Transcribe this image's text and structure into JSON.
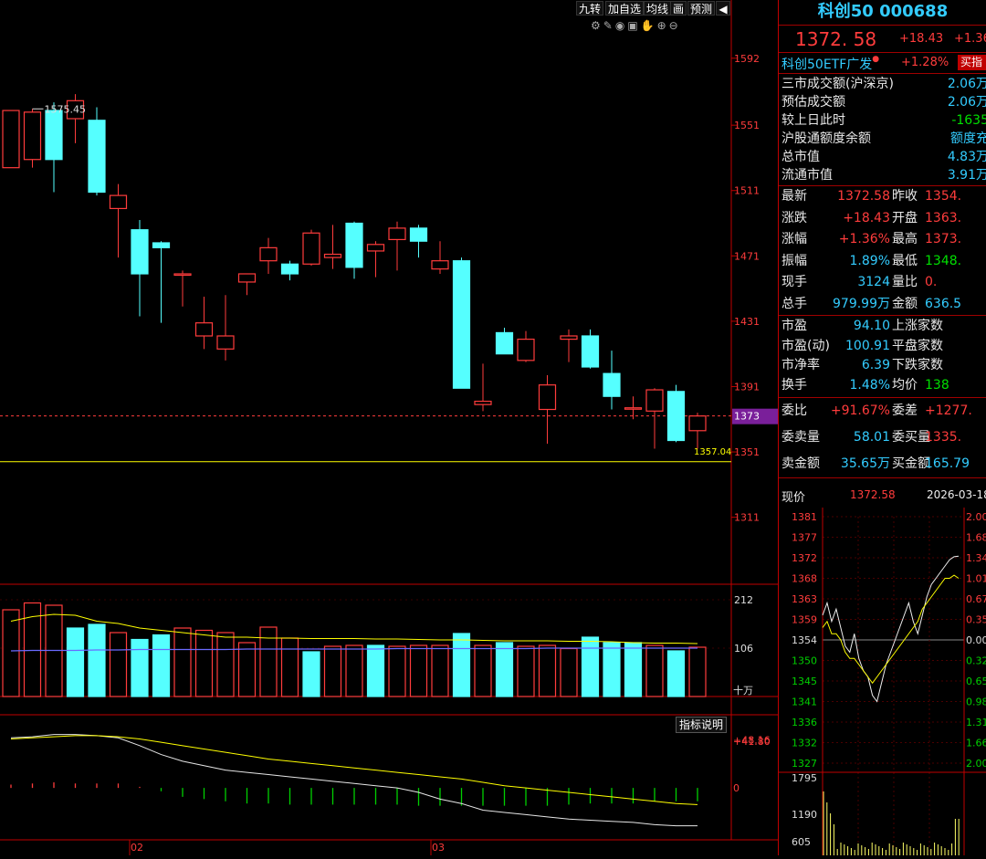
{
  "toolbar": {
    "buttons": [
      "九转",
      "加自选",
      "均线",
      "画",
      "预测"
    ],
    "right_icon": "speaker-icon"
  },
  "chart_icons": [
    "settings-icon",
    "pen-icon",
    "eye-icon",
    "trash-icon",
    "hand-icon",
    "zoom-in-icon",
    "zoom-out-icon"
  ],
  "colors": {
    "up": "#ff3c3c",
    "down": "#55ffff",
    "ma": "#ffff00",
    "panel_border": "#c00000",
    "price_tag": "#7a1f9a"
  },
  "chart_data": [
    {
      "type": "candlestick",
      "y_ticks": [
        1592,
        1551,
        1511,
        1471,
        1431,
        1391,
        1351,
        1311
      ],
      "ylim": [
        1270,
        1612
      ],
      "high_annotation": "1575.45",
      "current_price_tag": "1373",
      "support_line": "1357.04",
      "month_labels": [
        "02",
        "03"
      ],
      "candles": [
        {
          "o": 1525,
          "h": 1555,
          "l": 1525,
          "c": 1560
        },
        {
          "o": 1530,
          "h": 1561,
          "l": 1525,
          "c": 1559
        },
        {
          "o": 1560,
          "h": 1565,
          "l": 1510,
          "c": 1530
        },
        {
          "o": 1555,
          "h": 1570,
          "l": 1540,
          "c": 1566
        },
        {
          "o": 1554,
          "h": 1562,
          "l": 1508,
          "c": 1510
        },
        {
          "o": 1500,
          "h": 1515,
          "l": 1470,
          "c": 1508
        },
        {
          "o": 1487,
          "h": 1493,
          "l": 1434,
          "c": 1460
        },
        {
          "o": 1479,
          "h": 1480,
          "l": 1430,
          "c": 1476
        },
        {
          "o": 1460,
          "h": 1462,
          "l": 1440,
          "c": 1460
        },
        {
          "o": 1422,
          "h": 1446,
          "l": 1414,
          "c": 1430
        },
        {
          "o": 1414,
          "h": 1447,
          "l": 1407,
          "c": 1422
        },
        {
          "o": 1455,
          "h": 1460,
          "l": 1447,
          "c": 1460
        },
        {
          "o": 1468,
          "h": 1482,
          "l": 1460,
          "c": 1476
        },
        {
          "o": 1466,
          "h": 1468,
          "l": 1456,
          "c": 1460
        },
        {
          "o": 1466,
          "h": 1487,
          "l": 1465,
          "c": 1485
        },
        {
          "o": 1470,
          "h": 1490,
          "l": 1463,
          "c": 1472
        },
        {
          "o": 1491,
          "h": 1492,
          "l": 1457,
          "c": 1464
        },
        {
          "o": 1474,
          "h": 1480,
          "l": 1458,
          "c": 1478
        },
        {
          "o": 1481,
          "h": 1492,
          "l": 1462,
          "c": 1488
        },
        {
          "o": 1488,
          "h": 1490,
          "l": 1470,
          "c": 1480
        },
        {
          "o": 1463,
          "h": 1480,
          "l": 1460,
          "c": 1468
        },
        {
          "o": 1468,
          "h": 1470,
          "l": 1390,
          "c": 1390
        },
        {
          "o": 1380,
          "h": 1405,
          "l": 1376,
          "c": 1382
        },
        {
          "o": 1424,
          "h": 1427,
          "l": 1411,
          "c": 1411
        },
        {
          "o": 1407,
          "h": 1425,
          "l": 1406,
          "c": 1420
        },
        {
          "o": 1377,
          "h": 1398,
          "l": 1356,
          "c": 1392
        },
        {
          "o": 1420,
          "h": 1426,
          "l": 1406,
          "c": 1422
        },
        {
          "o": 1422,
          "h": 1426,
          "l": 1402,
          "c": 1403
        },
        {
          "o": 1399,
          "h": 1413,
          "l": 1377,
          "c": 1385
        },
        {
          "o": 1378,
          "h": 1385,
          "l": 1371,
          "c": 1378
        },
        {
          "o": 1376,
          "h": 1390,
          "l": 1353,
          "c": 1389
        },
        {
          "o": 1388,
          "h": 1392,
          "l": 1357,
          "c": 1358
        },
        {
          "o": 1364,
          "h": 1375,
          "l": 1353,
          "c": 1373
        }
      ]
    },
    {
      "type": "bar",
      "name": "volume",
      "y_ticks": [
        "212",
        "106",
        "十万"
      ],
      "ylim": [
        0,
        240
      ],
      "values": [
        190,
        205,
        200,
        150,
        158,
        140,
        125,
        135,
        150,
        145,
        140,
        118,
        152,
        128,
        98,
        110,
        112,
        112,
        110,
        112,
        112,
        138,
        112,
        118,
        110,
        112,
        105,
        130,
        118,
        118,
        112,
        100,
        108
      ],
      "up": [
        1,
        1,
        1,
        0,
        0,
        1,
        0,
        0,
        1,
        1,
        1,
        1,
        1,
        1,
        0,
        1,
        1,
        0,
        1,
        1,
        1,
        0,
        1,
        0,
        1,
        1,
        1,
        0,
        0,
        0,
        1,
        0,
        1
      ],
      "ma5": [
        165,
        175,
        180,
        178,
        165,
        160,
        150,
        145,
        140,
        135,
        130,
        130,
        128,
        128,
        127,
        127,
        127,
        126,
        126,
        125,
        124,
        124,
        123,
        122,
        122,
        122,
        121,
        121,
        120,
        118,
        117,
        117,
        116
      ],
      "ma10": [
        100,
        101,
        101,
        101,
        102,
        102,
        103,
        103,
        103,
        103,
        103,
        104,
        104,
        104,
        104,
        104,
        104,
        104,
        105,
        105,
        105,
        105,
        105,
        105,
        105,
        106,
        106,
        106,
        106,
        106,
        106,
        106,
        106
      ]
    },
    {
      "type": "macd",
      "button": "指标说明",
      "y_ticks": [
        "+48.16",
        "+41.80",
        "0"
      ],
      "ylim": [
        -45,
        60
      ],
      "dif": [
        45,
        46,
        48,
        48,
        47,
        45,
        38,
        30,
        24,
        20,
        16,
        14,
        12,
        10,
        8,
        6,
        4,
        2,
        0,
        -4,
        -10,
        -14,
        -20,
        -22,
        -24,
        -26,
        -28,
        -29,
        -30,
        -31,
        -33,
        -34,
        -34
      ],
      "dea": [
        44,
        45,
        46,
        47,
        47,
        46,
        44,
        41,
        38,
        35,
        32,
        29,
        26,
        24,
        22,
        20,
        18,
        16,
        14,
        12,
        10,
        8,
        5,
        2,
        0,
        -2,
        -4,
        -6,
        -8,
        -10,
        -12,
        -14,
        -15
      ],
      "hist": [
        3,
        4,
        5,
        4,
        4,
        4,
        1,
        -3,
        -8,
        -10,
        -12,
        -14,
        -14,
        -15,
        -15,
        -15,
        -15,
        -15,
        -15,
        -16,
        -16,
        -16,
        -16,
        -16,
        -16,
        -16,
        -15,
        -14,
        -14,
        -14,
        -12,
        -12,
        -12
      ]
    },
    {
      "type": "line",
      "name": "intraday",
      "y_ticks": [
        "1381",
        "1377",
        "1372",
        "1368",
        "1363",
        "1359",
        "1354",
        "1350",
        "1345",
        "1341",
        "1336",
        "1332",
        "1327"
      ],
      "pct_ticks": [
        "2.00",
        "1.68",
        "1.34",
        "1.01",
        "0.67",
        "0.35",
        "0.00",
        "0.32",
        "0.65",
        "0.98",
        "1.31",
        "1.66",
        "2.00"
      ],
      "vol_ticks": [
        "1795",
        "1190",
        "605"
      ]
    }
  ],
  "quote": {
    "title": "科创50 000688",
    "price": "1372. 58",
    "change": "+18.43",
    "pct": "+1.36",
    "etf_name": "科创50ETF广发",
    "etf_pct": "+1.28%",
    "buy_btn": "买指",
    "stats": [
      {
        "label": "三市成交额(沪深京)",
        "value": "2.06万"
      },
      {
        "label": "预估成交额",
        "value": "2.06万"
      },
      {
        "label": "较上日此时",
        "value": "-1635"
      },
      {
        "label": "沪股通额度余额",
        "value": "额度充"
      },
      {
        "label": "总市值",
        "value": "4.83万"
      },
      {
        "label": "流通市值",
        "value": "3.91万"
      }
    ],
    "grid": [
      {
        "l1": "最新",
        "v1": "1372.58",
        "l2": "昨收",
        "v2": "1354."
      },
      {
        "l1": "涨跌",
        "v1": "+18.43",
        "l2": "开盘",
        "v2": "1363."
      },
      {
        "l1": "涨幅",
        "v1": "+1.36%",
        "l2": "最高",
        "v2": "1373."
      },
      {
        "l1": "振幅",
        "v1": "1.89%",
        "l2": "最低",
        "v2": "1348."
      },
      {
        "l1": "现手",
        "v1": "3124",
        "l2": "量比",
        "v2": "0."
      },
      {
        "l1": "总手",
        "v1": "979.99万",
        "l2": "金额",
        "v2": "636.5"
      }
    ],
    "grid2": [
      {
        "l1": "市盈",
        "v1": "94.10",
        "l2": "上涨家数",
        "v2": ""
      },
      {
        "l1": "市盈(动)",
        "v1": "100.91",
        "l2": "平盘家数",
        "v2": ""
      },
      {
        "l1": "市净率",
        "v1": "6.39",
        "l2": "下跌家数",
        "v2": ""
      },
      {
        "l1": "换手",
        "v1": "1.48%",
        "l2": "均价",
        "v2": "138"
      }
    ],
    "order": [
      {
        "l1": "委比",
        "v1": "+91.67%",
        "l2": "委差",
        "v2": "+1277."
      },
      {
        "l1": "委卖量",
        "v1": "58.01",
        "l2": "委买量",
        "v2": "1335."
      },
      {
        "l1": "卖金额",
        "v1": "35.65万",
        "l2": "买金额",
        "v2": "165.79"
      }
    ],
    "intraday_header": {
      "label": "现价",
      "price": "1372.58",
      "date": "2026-03-18"
    }
  }
}
